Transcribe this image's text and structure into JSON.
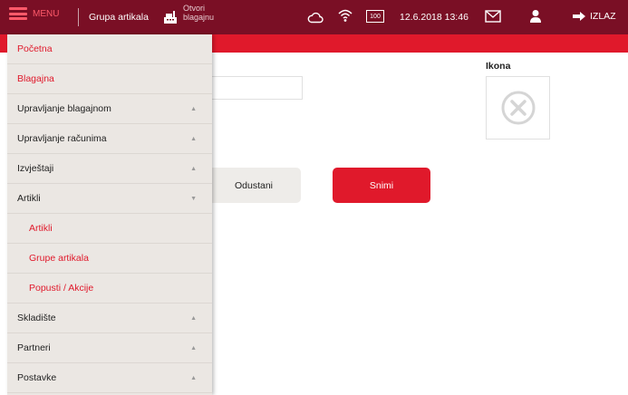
{
  "topbar": {
    "menu_label": "MENU",
    "title": "Grupa artikala",
    "open_register_line1": "Otvori",
    "open_register_line2": "blagajnu",
    "battery_label": "100",
    "datetime": "12.6.2018 13:46",
    "logout_label": "IZLAZ"
  },
  "form": {
    "icon_label": "Ikona",
    "cancel_label": "Odustani",
    "save_label": "Snimi"
  },
  "drawer": {
    "items": [
      {
        "label": "Početna"
      },
      {
        "label": "Blagajna"
      },
      {
        "label": "Upravljanje blagajnom",
        "caret": "▲"
      },
      {
        "label": "Upravljanje računima",
        "caret": "▲"
      },
      {
        "label": "Izvještaji",
        "caret": "▲"
      },
      {
        "label": "Artikli",
        "caret": "▼"
      },
      {
        "label": "Artikli"
      },
      {
        "label": "Grupe artikala"
      },
      {
        "label": "Popusti / Akcije"
      },
      {
        "label": "Skladište",
        "caret": "▲"
      },
      {
        "label": "Partneri",
        "caret": "▲"
      },
      {
        "label": "Postavke",
        "caret": "▲"
      }
    ]
  },
  "colors": {
    "topbar": "#7a0f25",
    "accent": "#e0192b",
    "drawer_bg": "#ebe7e3"
  },
  "icons": [
    "hamburger-icon",
    "cash-register-icon",
    "cloud-icon",
    "wifi-icon",
    "battery-icon",
    "mail-icon",
    "user-icon",
    "arrow-right-icon",
    "close-circle-icon"
  ]
}
